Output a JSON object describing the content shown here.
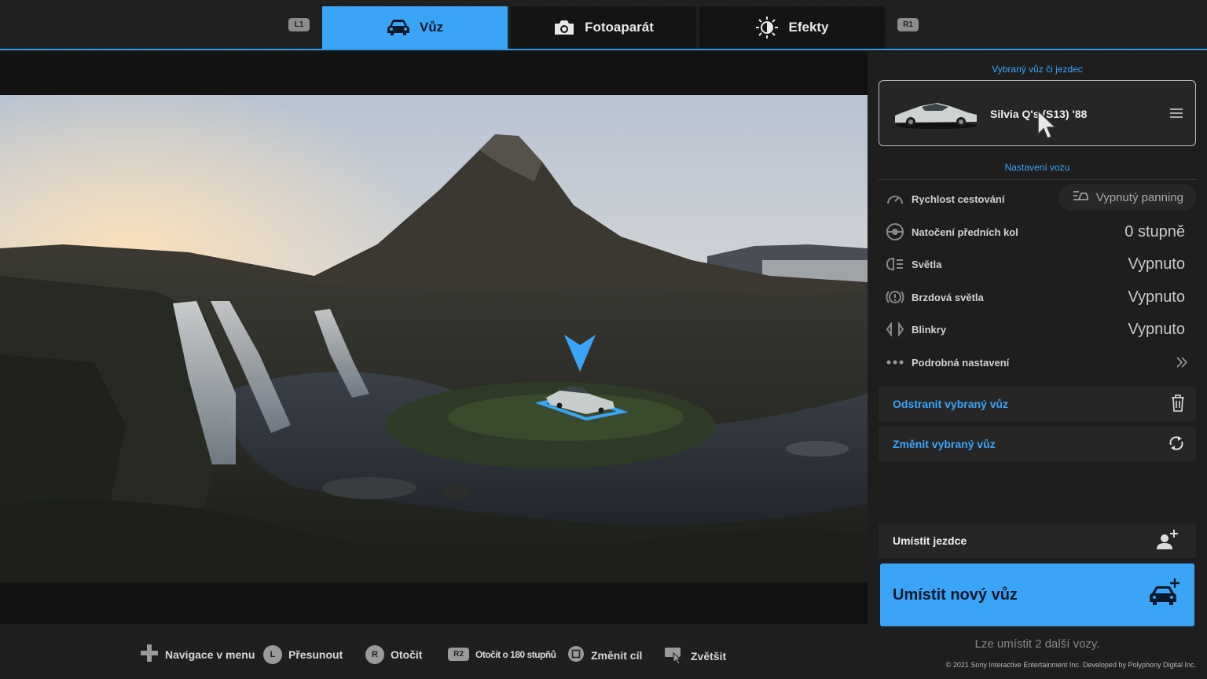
{
  "topbar": {
    "l1": "L1",
    "r1": "R1",
    "tabs": [
      {
        "label": "Vůz",
        "icon": "car-icon",
        "active": true
      },
      {
        "label": "Fotoaparát",
        "icon": "camera-icon",
        "active": false
      },
      {
        "label": "Efekty",
        "icon": "brightness-icon",
        "active": false
      }
    ]
  },
  "panel": {
    "selected_title": "Vybraný vůz či jezdec",
    "selected_car": "Silvia Q's (S13) '88",
    "settings_title": "Nastavení vozu",
    "rows": [
      {
        "label": "Rychlost cestování",
        "value": "Vypnutý panning",
        "icon": "speedometer-icon"
      },
      {
        "label": "Natočení předních kol",
        "value": "0 stupně",
        "icon": "steering-wheel-icon"
      },
      {
        "label": "Světla",
        "value": "Vypnuto",
        "icon": "headlight-icon"
      },
      {
        "label": "Brzdová světla",
        "value": "Vypnuto",
        "icon": "brake-light-icon"
      },
      {
        "label": "Blinkry",
        "value": "Vypnuto",
        "icon": "blinker-icon"
      },
      {
        "label": "Podrobná nastavení",
        "value": "",
        "icon": "more-icon"
      }
    ],
    "remove_label": "Odstranit vybraný vůz",
    "change_label": "Změnit vybraný vůz",
    "place_rider_label": "Umístit jezdce",
    "place_car_label": "Umístit nový vůz",
    "remaining_text": "Lze umístit 2 další vozy.",
    "copyright": "© 2021 Sony Interactive Entertainment Inc. Developed by Polyphony Digital Inc."
  },
  "bottombar": {
    "hints": [
      {
        "button": "",
        "label": "Navigace v menu"
      },
      {
        "button": "L",
        "label": "Přesunout"
      },
      {
        "button": "R",
        "label": "Otočit"
      },
      {
        "button": "R2",
        "label": "Otočit o 180 stupňů"
      },
      {
        "button": "",
        "label": "Změnit cíl"
      },
      {
        "button": "",
        "label": "Zvětšit"
      }
    ]
  },
  "colors": {
    "accent": "#3aa5f7",
    "panel_bg": "#1e1e1e",
    "row_bg": "#262626"
  }
}
